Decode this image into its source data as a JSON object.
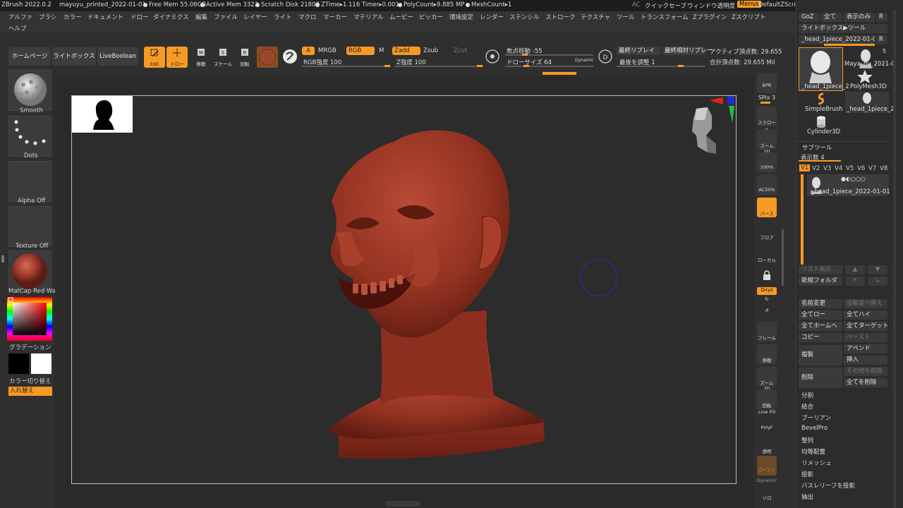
{
  "titlebar": {
    "app": "ZBrush 2022.0.2",
    "file": "mayuyu_printed_2022-01-01",
    "free_mem": "Free Mem 55.06GB",
    "active_mem": "Active Mem 3323",
    "scratch": "Scratch Disk 21809",
    "ztime": "ZTime▸1.116 Timer▸0.001",
    "polycount": "PolyCount▸9.885 MP",
    "meshcount": "MeshCount▸1",
    "ac": "AC",
    "quicksave": "クイックセーブ",
    "window_transparency": "ウィンドウ透明度",
    "menus": "Menus",
    "script": "DefaultZScript"
  },
  "menubar": {
    "items": [
      "アルファ",
      "ブラシ",
      "カラー",
      "ドキュメント",
      "ドロー",
      "ダイナミクス",
      "編集",
      "ファイル",
      "レイヤー",
      "ライト",
      "マクロ",
      "マーカー",
      "マテリアル",
      "ムービー",
      "ピッカー",
      "環境設定",
      "レンダー",
      "ステンシル",
      "ストローク",
      "テクスチャ",
      "ツール",
      "トランスフォーム",
      "Zプラグイン",
      "Zスクリプト"
    ],
    "help": "ヘルプ"
  },
  "toolbar": {
    "home": "ホームページ",
    "lightbox": "ライトボックス",
    "liveboolean": "LiveBoolean",
    "edit": "Edit",
    "draw": "ドロー",
    "move": "移動",
    "scale": "スケール",
    "rotate": "回転",
    "a": "A",
    "mrgb": "MRGB",
    "rgb": "RGB",
    "m": "M",
    "rgb_intensity": "RGB強度 100",
    "zadd": "Zadd",
    "zsub": "Zsub",
    "zcut": "Zcut",
    "z_intensity": "Z強度 100",
    "focal_shift": "焦点移動 -55",
    "draw_size": "ドローサイズ 64",
    "dynamic": "Dynamic",
    "last_replay": "最終リプレイ",
    "last_rel_replay": "最終相対リプレー",
    "adjust_last": "最後を調整 1",
    "active_points": "アクティブ頂点数: 29.655",
    "total_points": "合計頂点数: 29.655 Mil"
  },
  "leftshelf": {
    "brush": "Smooth",
    "stroke": "Dots",
    "alpha": "Alpha Off",
    "texture": "Texture Off",
    "material": "MatCap Red Wax",
    "gradient": "グラデーション",
    "switch_color": "カラー切り替え",
    "swap": "入れ替え"
  },
  "rightshelf": {
    "bpr": "BPR",
    "spix": "SPix 3",
    "scroll": "スクロール",
    "zoom2d": "ズーム2D",
    "pct100": "100%",
    "ac50": "AC50%",
    "persp": "パース",
    "floor": "フロア",
    "local": "ローカル",
    "xyz": "Qxyz",
    "frame": "フレーム",
    "move": "移動",
    "zoom3d": "ズーム3D",
    "rotate": "回転",
    "linefill": "Line Fill",
    "polyf": "PolyF",
    "transp": "透明",
    "ghost": "ゴースト",
    "dynamic": "Dynamic",
    "solo": "ソロ"
  },
  "rightpanel": {
    "goz": "GoZ",
    "all": "全て",
    "visible": "表示のみ",
    "r": "R",
    "lightbox_tool": "ライトボックス▶ツール",
    "current_tool": "_head_1piece_2022-01-01",
    "thumbs": [
      "_head_1piece_2",
      "Maya_ov_2021-0",
      "PolyMesh3D",
      "SimpleBrush",
      "_head_1piece_2",
      "Cylinder3D"
    ],
    "count5": "5",
    "subtool_title": "サブツール",
    "visible_count": "表示数 4",
    "versions": [
      "V1",
      "V2",
      "V3",
      "V4",
      "V5",
      "V6",
      "V7",
      "V8"
    ],
    "subtool_name": "_head_1piece_2022-01-01",
    "list_view": "リスト表示",
    "new_folder": "新規フォルダ",
    "rename": "名前変更",
    "auto_reorder": "自動並べ替え",
    "all_low": "全てロー",
    "all_high": "全てハイ",
    "all_home": "全てホームへ",
    "all_target": "全てターゲットへ",
    "copy": "コピー",
    "paste": "ペースト",
    "duplicate": "複製",
    "append": "アペンド",
    "insert": "挿入",
    "delete": "削除",
    "delete_others": "その他を削除",
    "delete_all": "全てを削除",
    "split": "分割",
    "merge": "結合",
    "boolean": "ブーリアン",
    "bevelpro": "BevelPro",
    "align": "整列",
    "distribute": "均等配置",
    "remesh": "リメッシュ",
    "project": "投影",
    "project_bas": "バスレリーフを投影",
    "extract": "抽出"
  },
  "colors": {
    "accent": "#f59a23",
    "model": "#9c3a2c",
    "background": "#2e2e2e"
  }
}
